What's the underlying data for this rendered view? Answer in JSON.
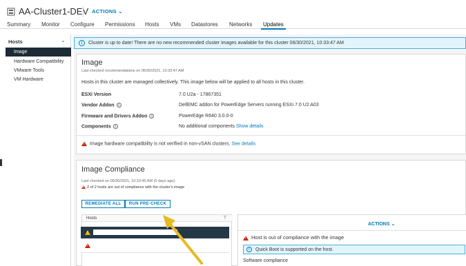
{
  "header": {
    "title": "AA-Cluster1-DEV",
    "actions_label": "ACTIONS",
    "tabs": [
      "Summary",
      "Monitor",
      "Configure",
      "Permissions",
      "Hosts",
      "VMs",
      "Datastores",
      "Networks",
      "Updates"
    ],
    "active_tab": "Updates"
  },
  "sidebar": {
    "heading": "Hosts",
    "items": [
      {
        "label": "Image"
      },
      {
        "label": "Hardware Compatibility"
      },
      {
        "label": "VMware Tools"
      },
      {
        "label": "VM Hardware"
      }
    ]
  },
  "banner": {
    "text": "Cluster is up to date! There are no new recommended cluster images available for this cluster 06/30/2021, 10:33:47 AM"
  },
  "image_card": {
    "title": "Image",
    "last_checked": "Last checked recommendations on 06/30/2021, 10:33:47 AM",
    "description": "Hosts in this cluster are managed collectively. This image below will be applied to all hosts in this cluster.",
    "esxi_label": "ESXi Version",
    "esxi_value": "7.0 U2a - 17867351",
    "vendor_label": "Vendor Addon",
    "vendor_value": "DellEMC addon for PowerEdge Servers running ESXi 7.0 U2 A03",
    "firmware_label": "Firmware and Drivers Addon",
    "firmware_value": "PowerEdge R640 3.0.0-0",
    "components_label": "Components",
    "components_value": "No additional components",
    "components_link": "Show details",
    "hw_warning": "Image hardware compatibility is not verified in non-vSAN clusters.",
    "hw_link": "See details"
  },
  "compliance_card": {
    "title": "Image Compliance",
    "last_checked": "Last checked on 06/30/2021, 10:33:45 AM (0 days ago)",
    "status": "2 of 2 hosts are out of compliance with the cluster's image",
    "remediate_label": "REMEDIATE ALL",
    "precheck_label": "RUN PRE-CHECK",
    "hosts_header": "Hosts",
    "detail_dot": ".",
    "detail_actions": "ACTIONS",
    "detail_warning": "Host is out of compliance with the image",
    "quickboot": "Quick Boot is supported on the host.",
    "software_compliance": "Software compliance"
  },
  "colors": {
    "accent": "#0079b8",
    "selected_row": "#253846",
    "warning_red": "#c92100",
    "warning_yellow": "#f0ad00",
    "info_bg": "#e3f5fc",
    "arrow": "#e8b923"
  }
}
